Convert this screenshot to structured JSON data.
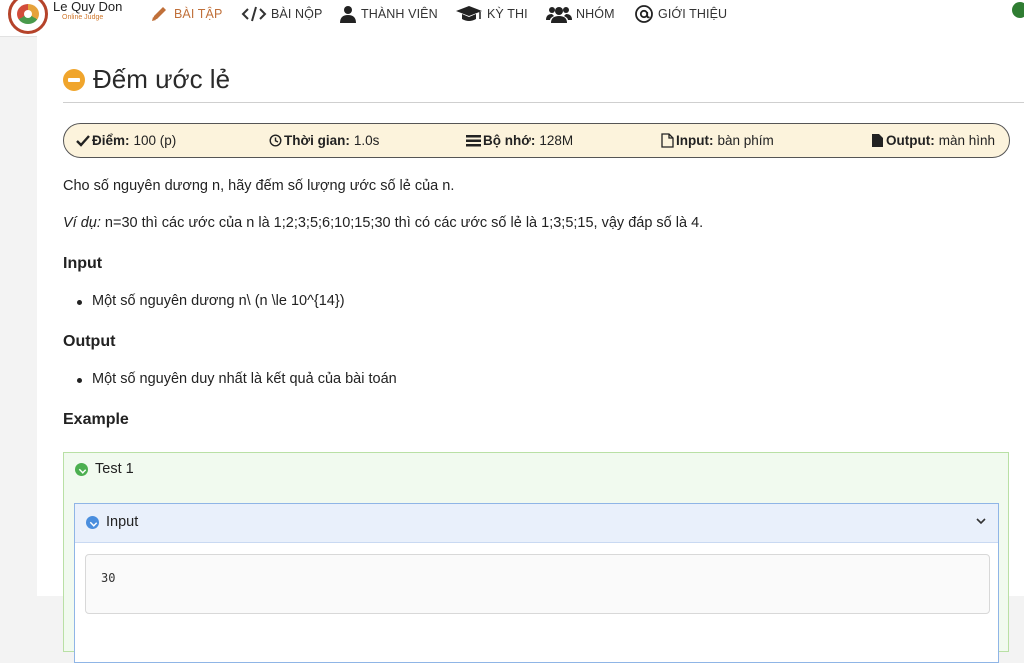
{
  "brand": {
    "name": "Le Quy Don",
    "sub": "Online Judge"
  },
  "nav": [
    {
      "label": "BÀI TẬP",
      "icon": "pencil-icon"
    },
    {
      "label": "BÀI NỘP",
      "icon": "code-icon"
    },
    {
      "label": "THÀNH VIÊN",
      "icon": "user-icon"
    },
    {
      "label": "KỲ THI",
      "icon": "graduation-cap-icon"
    },
    {
      "label": "NHÓM",
      "icon": "users-icon"
    },
    {
      "label": "GIỚI THIỆU",
      "icon": "at-icon"
    }
  ],
  "colors": {
    "accent": "#c0703a",
    "title_icon": "#f0a52c",
    "info_bg": "#fcf3dc",
    "test_border": "#b9e0a5"
  },
  "problem": {
    "title": "Đếm ước lẻ",
    "points_label": "Điểm:",
    "points_value": "100 (p)",
    "time_label": "Thời gian:",
    "time_value": "1.0s",
    "memory_label": "Bộ nhớ:",
    "memory_value": "128M",
    "input_label": "Input:",
    "input_value": "bàn phím",
    "output_label": "Output:",
    "output_value": "màn hình",
    "statement": "Cho số nguyên dương n, hãy đếm số lượng ước số lẻ của n.",
    "example_prefix": "Ví dụ:",
    "example_text": "n=30 thì các ước của n là 1;2;3;5;6;10;15;30 thì có các ước số lẻ là 1;3;5;15, vậy đáp số là 4.",
    "input_heading": "Input",
    "input_bullet": "Một số nguyên dương n\\ (n \\le 10^{14})",
    "output_heading": "Output",
    "output_bullet": "Một số nguyên duy nhất là kết quả của bài toán",
    "example_heading": "Example"
  },
  "test": {
    "title": "Test 1",
    "input_label": "Input",
    "input_value": "30"
  }
}
